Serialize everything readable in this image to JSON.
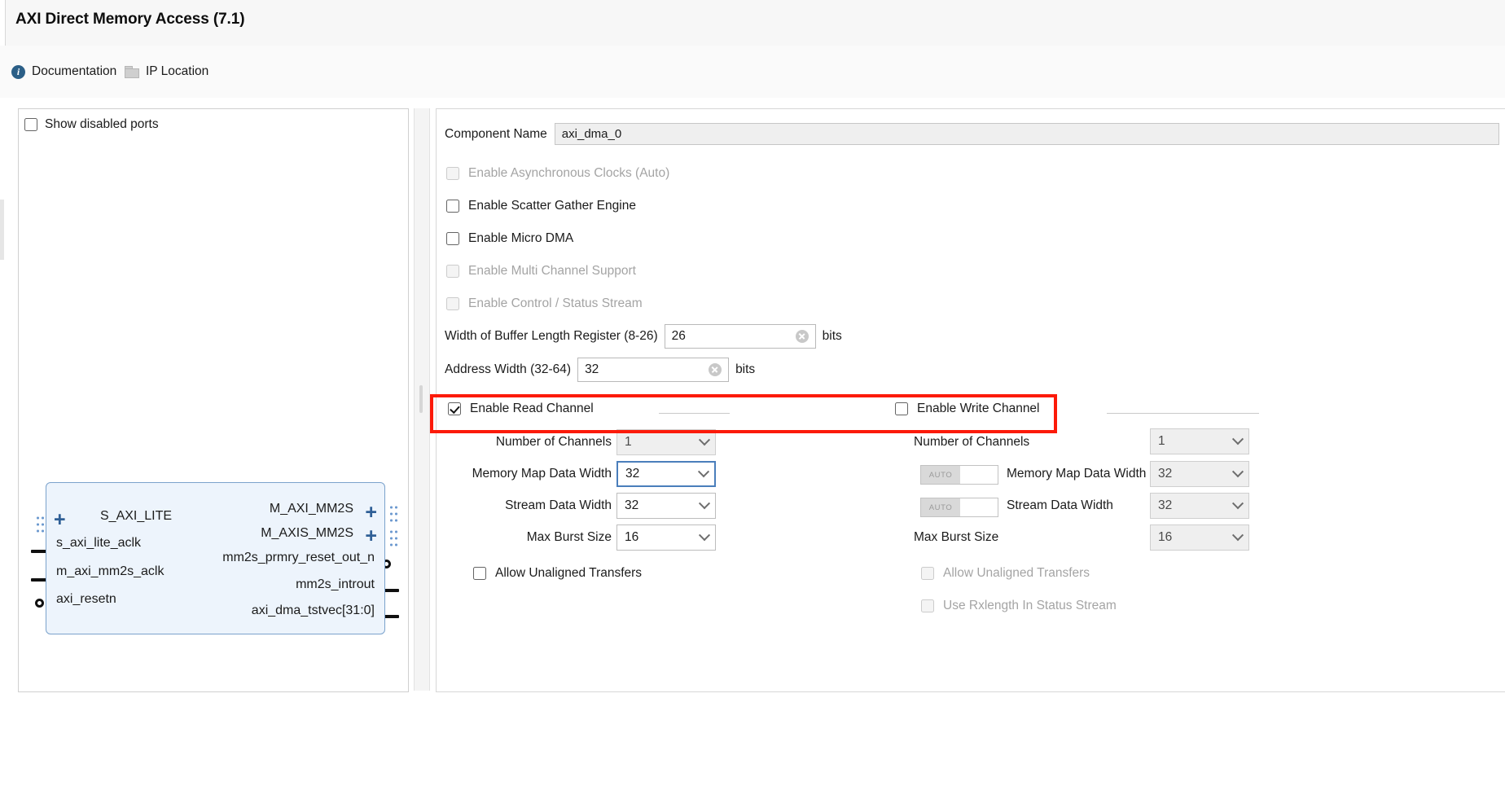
{
  "dialog": {
    "title": "AXI Direct Memory Access (7.1)"
  },
  "toolbar": {
    "documentation": "Documentation",
    "ip_location": "IP Location"
  },
  "preview": {
    "show_disabled_ports": "Show disabled ports",
    "block": {
      "left_ports": [
        "S_AXI_LITE",
        "s_axi_lite_aclk",
        "m_axi_mm2s_aclk",
        "axi_resetn"
      ],
      "right_ports": [
        "M_AXI_MM2S",
        "M_AXIS_MM2S",
        "mm2s_prmry_reset_out_n",
        "mm2s_introut",
        "axi_dma_tstvec[31:0]"
      ]
    }
  },
  "form": {
    "component_name_label": "Component Name",
    "component_name_value": "axi_dma_0",
    "checkboxes": [
      {
        "label": "Enable Asynchronous Clocks (Auto)",
        "checked": false,
        "disabled": true
      },
      {
        "label": "Enable Scatter Gather Engine",
        "checked": false,
        "disabled": false
      },
      {
        "label": "Enable Micro DMA",
        "checked": false,
        "disabled": false
      },
      {
        "label": "Enable Multi Channel Support",
        "checked": false,
        "disabled": true
      },
      {
        "label": "Enable Control / Status Stream",
        "checked": false,
        "disabled": true
      }
    ],
    "buffer_length": {
      "label": "Width of Buffer Length Register (8-26)",
      "value": "26",
      "units": "bits"
    },
    "address_width": {
      "label": "Address Width (32-64)",
      "value": "32",
      "units": "bits"
    },
    "read_channel": {
      "header": "Enable Read Channel",
      "checked": true,
      "fields": [
        {
          "label": "Number of Channels",
          "value": "1",
          "disabled": true,
          "focused": false
        },
        {
          "label": "Memory Map Data Width",
          "value": "32",
          "disabled": false,
          "focused": true
        },
        {
          "label": "Stream Data Width",
          "value": "32",
          "disabled": false,
          "focused": false
        },
        {
          "label": "Max Burst Size",
          "value": "16",
          "disabled": false,
          "focused": false
        }
      ],
      "options": [
        {
          "label": "Allow Unaligned Transfers",
          "checked": false,
          "disabled": false
        }
      ]
    },
    "write_channel": {
      "header": "Enable Write Channel",
      "checked": false,
      "fields": [
        {
          "label": "Number of Channels",
          "value": "1",
          "disabled": true,
          "auto": false
        },
        {
          "label": "Memory Map Data Width",
          "value": "32",
          "disabled": true,
          "auto": true
        },
        {
          "label": "Stream Data Width",
          "value": "32",
          "disabled": true,
          "auto": true
        },
        {
          "label": "Max Burst Size",
          "value": "16",
          "disabled": true,
          "auto": false
        }
      ],
      "auto_label": "AUTO",
      "options": [
        {
          "label": "Allow Unaligned Transfers",
          "checked": false,
          "disabled": true
        },
        {
          "label": "Use Rxlength In Status Stream",
          "checked": false,
          "disabled": true
        }
      ]
    }
  },
  "highlight": {
    "color": "#fc1a09"
  }
}
